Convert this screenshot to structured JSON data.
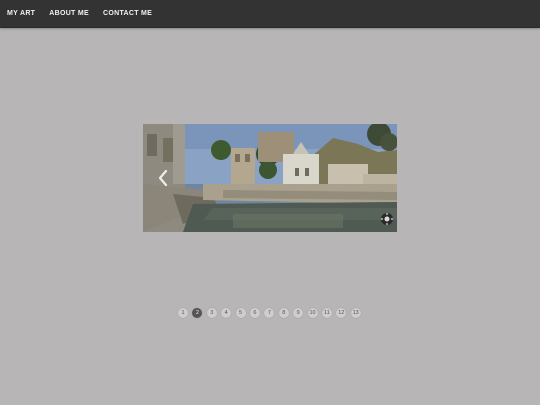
{
  "nav": {
    "items": [
      {
        "label": "MY ART"
      },
      {
        "label": "ABOUT ME"
      },
      {
        "label": "CONTACT ME"
      }
    ]
  },
  "slideshow": {
    "prev_icon": "chevron-left-icon",
    "badge_icon": "settings-badge-icon",
    "active_page": 2,
    "pages": [
      "1",
      "2",
      "3",
      "4",
      "5",
      "6",
      "7",
      "8",
      "9",
      "10",
      "11",
      "12",
      "13"
    ]
  },
  "colors": {
    "topbar": "#333333",
    "background": "#b7b5b6",
    "active_dot": "#555555",
    "dot": "#cfcdce"
  }
}
